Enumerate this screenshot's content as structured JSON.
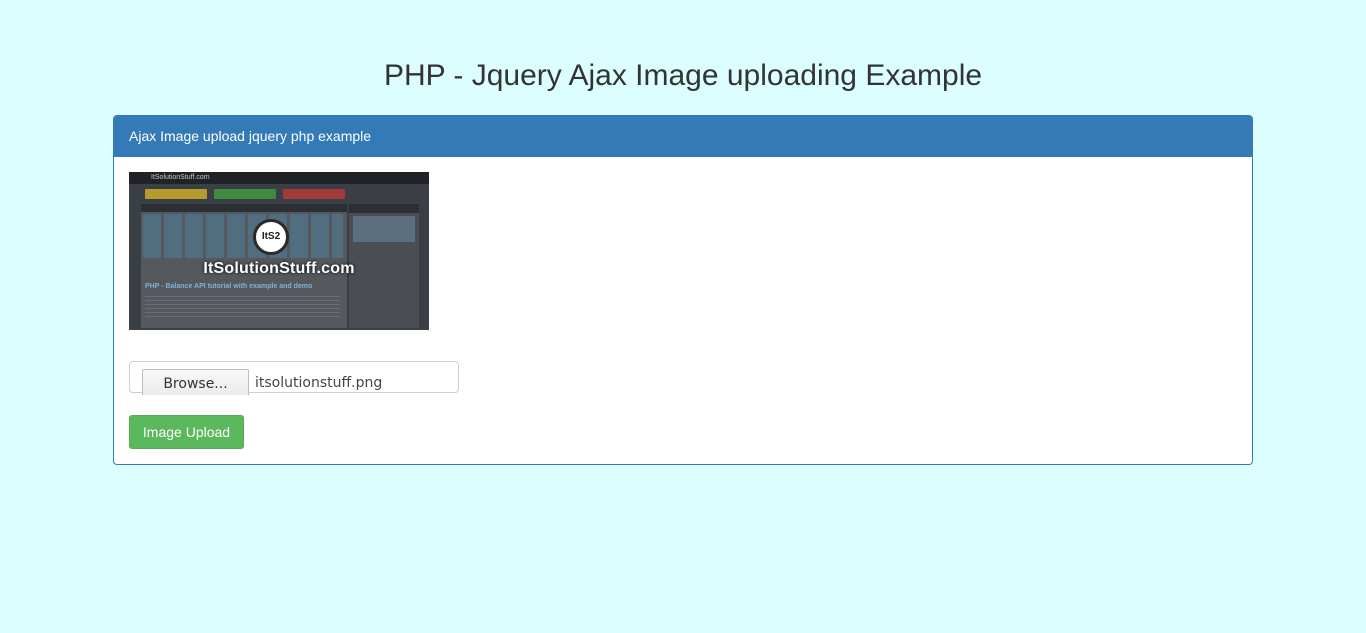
{
  "page": {
    "title": "PHP - Jquery Ajax Image uploading Example"
  },
  "panel": {
    "heading": "Ajax Image upload jquery php example",
    "preview": {
      "site_label": "ItSolutionStuff.com",
      "logo_badge": "ItS2",
      "logo_text": "ItSolutionStuff.com",
      "post_title": "PHP - Balance API tutorial with example and demo"
    },
    "file_input": {
      "browse_label": "Browse...",
      "file_name": "itsolutionstuff.png"
    },
    "upload_button": "Image Upload"
  },
  "colors": {
    "background": "#dcfefe",
    "primary": "#337ab7",
    "success": "#5cb85c"
  }
}
